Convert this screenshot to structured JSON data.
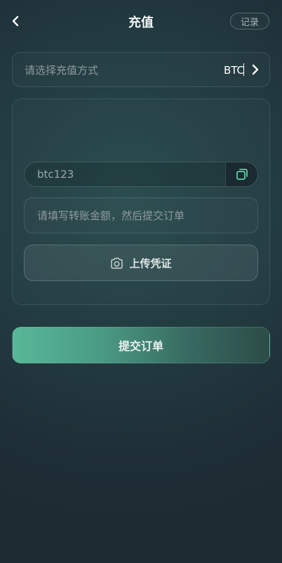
{
  "header": {
    "title": "充值",
    "back_icon": "chevron-left-icon",
    "record_label": "记录"
  },
  "method": {
    "placeholder": "请选择充值方式",
    "selected": "BTC",
    "chevron_icon": "chevron-right-icon"
  },
  "card": {
    "address": "btc123",
    "copy_icon": "copy-icon",
    "amount_placeholder": "请填写转账金额，然后提交订单",
    "upload_icon": "camera-icon",
    "upload_label": "上传凭证"
  },
  "submit": {
    "label": "提交订单"
  },
  "colors": {
    "accent_start": "#58b898",
    "background": "#223b41"
  }
}
